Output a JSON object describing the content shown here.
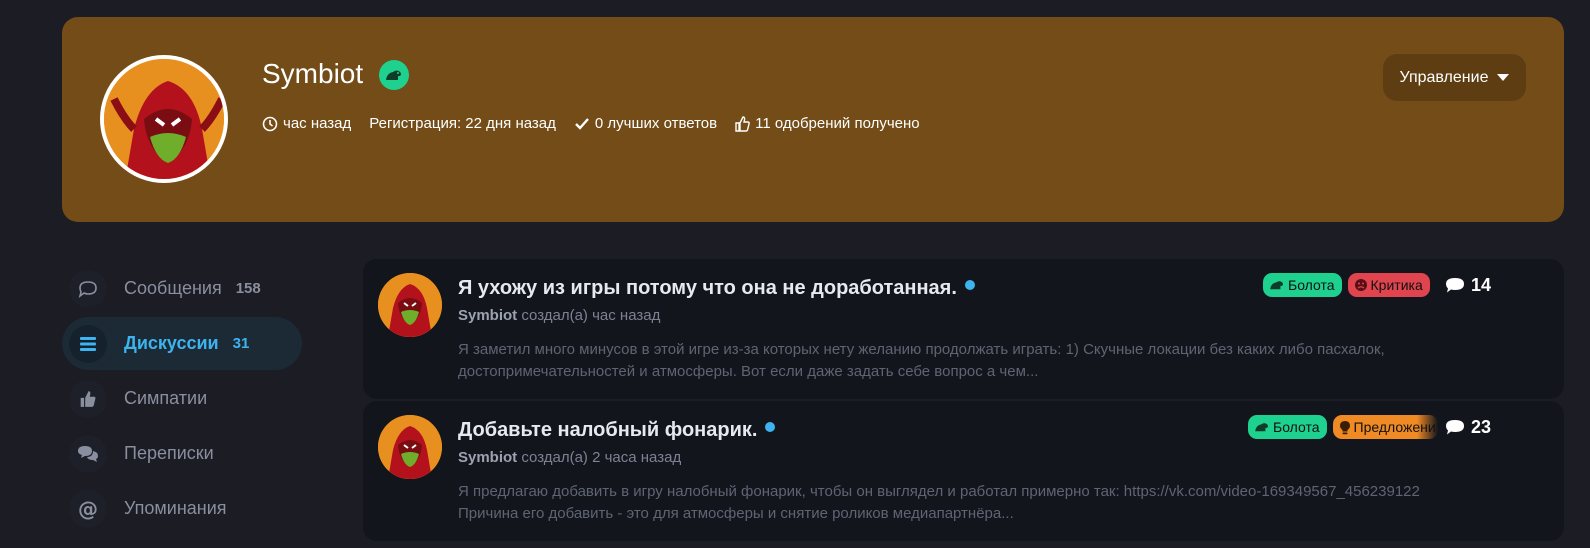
{
  "profile": {
    "username": "Symbiot",
    "last_seen": "час назад",
    "registration": "Регистрация: 22 дня назад",
    "best_answers": "0 лучших ответов",
    "likes_received": "11 одобрений получено",
    "manage_label": "Управление",
    "banner_color": "#734c17",
    "badge_color": "#1fd18e"
  },
  "sidebar": {
    "items": [
      {
        "label": "Сообщения",
        "count": "158",
        "icon": "speech-bubble-icon"
      },
      {
        "label": "Дискуссии",
        "count": "31",
        "icon": "list-icon",
        "active": true
      },
      {
        "label": "Симпатии",
        "count": "",
        "icon": "thumbs-up-icon"
      },
      {
        "label": "Переписки",
        "count": "",
        "icon": "chat-bubbles-icon"
      },
      {
        "label": "Упоминания",
        "count": "",
        "icon": "at-icon"
      }
    ],
    "active_color": "#3db4ef"
  },
  "threads": [
    {
      "title": "Я ухожу из игры потому что она не доработанная.",
      "author": "Symbiot",
      "meta": "создал(а) час назад",
      "snippet": "Я заметил много минусов в этой игре из-за которых нету желанию продолжать играть: 1) Скучные локации без каких либо пасхалок, достопримечательностей и атмосферы. Вот если даже задать себе вопрос а чем...",
      "tags": [
        {
          "label": "Болота",
          "color": "#1fd18e"
        },
        {
          "label": "Критика",
          "color": "#e0454f"
        }
      ],
      "replies": "14"
    },
    {
      "title": "Добавьте налобный фонарик.",
      "author": "Symbiot",
      "meta": "создал(а) 2 часа назад",
      "snippet": "Я предлагаю добавить в игру налобный фонарик, чтобы он выглядел и работал примерно так: https://vk.com/video-169349567_456239122 Причина его добавить - это для атмосферы и снятие роликов медиапартнёра...",
      "tags": [
        {
          "label": "Болота",
          "color": "#1fd18e"
        },
        {
          "label": "Предложени",
          "color": "#f08a24"
        }
      ],
      "replies": "23"
    }
  ]
}
